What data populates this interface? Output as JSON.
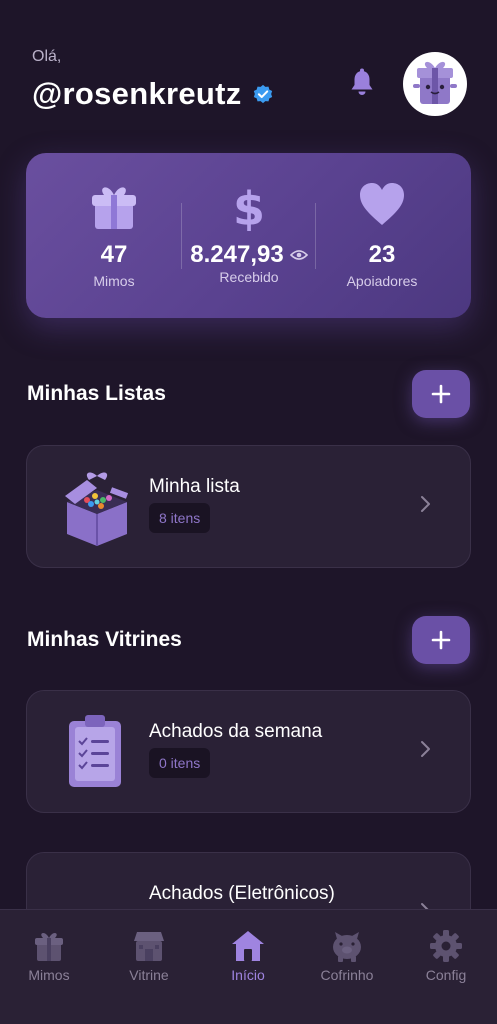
{
  "header": {
    "greeting": "Olá,",
    "username": "@rosenkreutz"
  },
  "stats": [
    {
      "value": "47",
      "label": "Mimos",
      "icon": "gift-icon"
    },
    {
      "value": "8.247,93",
      "label": "Recebido",
      "icon": "dollar-icon"
    },
    {
      "value": "23",
      "label": "Apoiadores",
      "icon": "heart-icon"
    }
  ],
  "lists_section": {
    "title": "Minhas Listas",
    "items": [
      {
        "title": "Minha lista",
        "count": "8 itens",
        "icon": "gift-box-icon"
      }
    ]
  },
  "showcases_section": {
    "title": "Minhas Vitrines",
    "items": [
      {
        "title": "Achados da semana",
        "count": "0 itens",
        "icon": "clipboard-icon"
      },
      {
        "title": "Achados (Eletrônicos)",
        "count": "",
        "icon": ""
      }
    ]
  },
  "bottom_nav": [
    {
      "label": "Mimos",
      "icon": "gift-icon",
      "active": false
    },
    {
      "label": "Vitrine",
      "icon": "store-icon",
      "active": false
    },
    {
      "label": "Início",
      "icon": "home-icon",
      "active": true
    },
    {
      "label": "Cofrinho",
      "icon": "piggy-bank-icon",
      "active": false
    },
    {
      "label": "Config",
      "icon": "gear-icon",
      "active": false
    }
  ],
  "colors": {
    "background": "#1e1529",
    "accent": "#6a50a6",
    "card": "#2a2136",
    "active_nav": "#9f84e0"
  }
}
